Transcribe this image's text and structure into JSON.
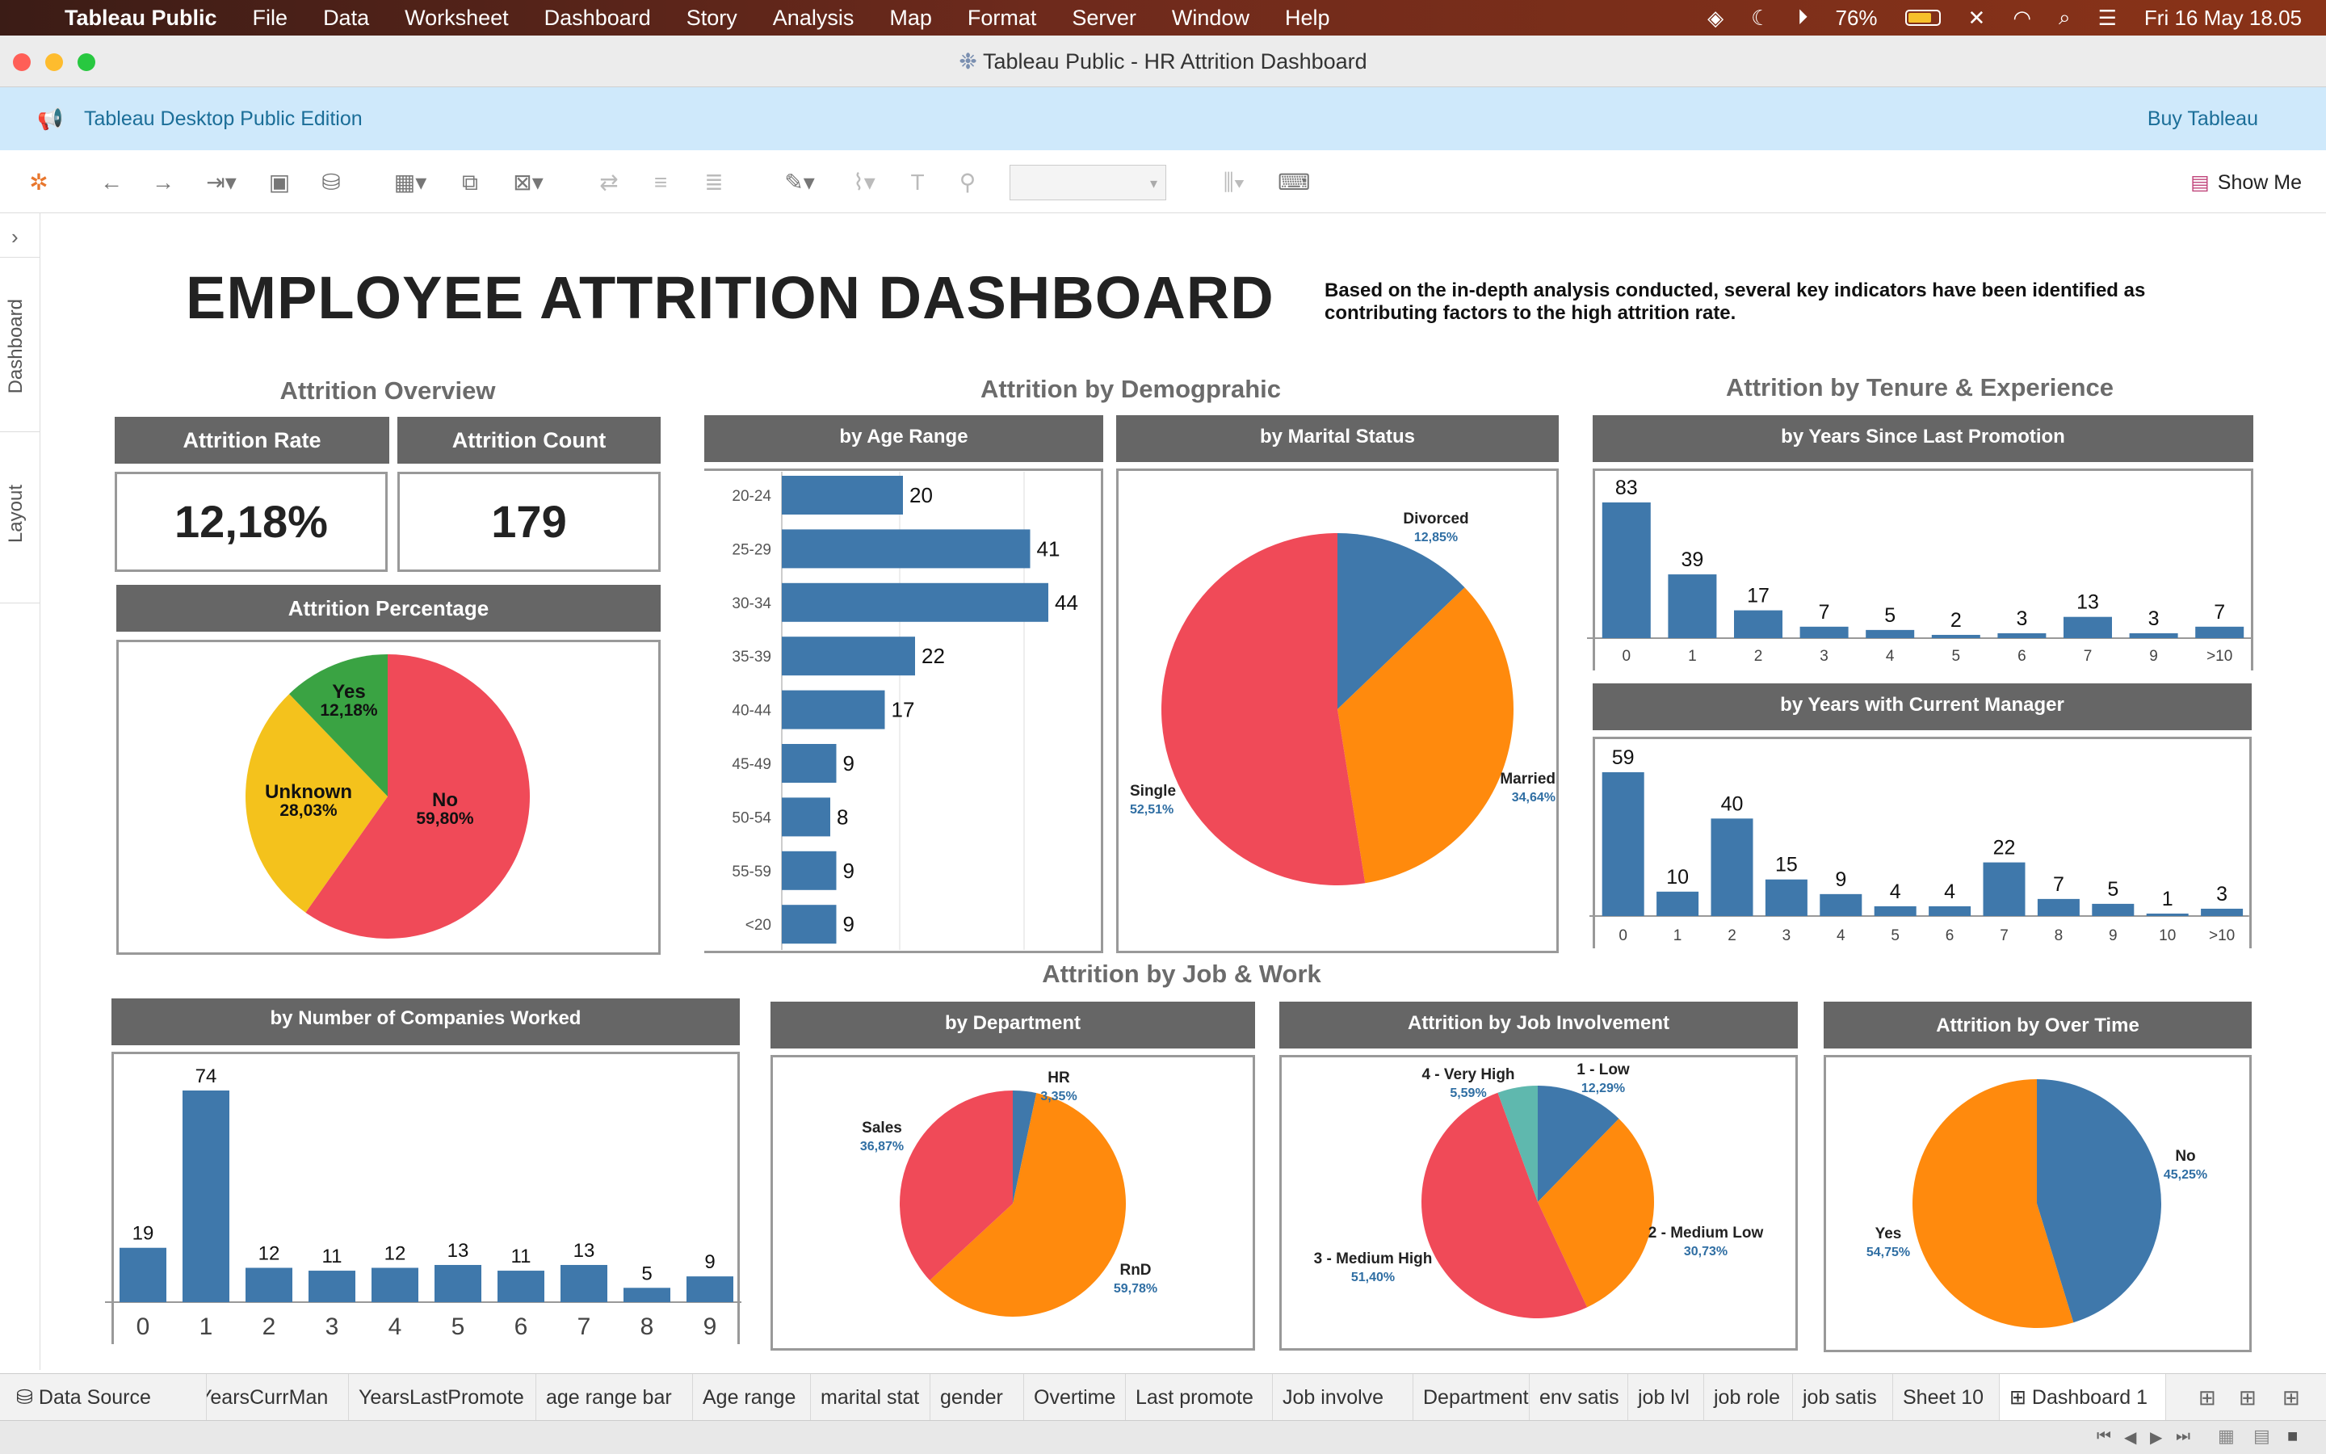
{
  "menubar": {
    "app": "Tableau Public",
    "items": [
      "File",
      "Data",
      "Worksheet",
      "Dashboard",
      "Story",
      "Analysis",
      "Map",
      "Format",
      "Server",
      "Window",
      "Help"
    ],
    "battery": "76%",
    "datetime": "Fri 16 May  18.05"
  },
  "window": {
    "title": "Tableau Public - HR Attrition Dashboard"
  },
  "banner": {
    "edition": "Tableau Desktop Public Edition",
    "buy": "Buy Tableau"
  },
  "toolbar": {
    "show_me": "Show Me"
  },
  "side": {
    "dashboard": "Dashboard",
    "layout": "Layout"
  },
  "dashboard": {
    "title": "EMPLOYEE ATTRITION DASHBOARD",
    "description": "Based on the in-depth analysis conducted, several key indicators have been identified as contributing factors to the high attrition rate.",
    "sections": {
      "overview": "Attrition Overview",
      "demographic": "Attrition by Demogprahic",
      "tenure": "Attrition by Tenure & Experience",
      "job": "Attrition by Job & Work"
    },
    "kpis": [
      {
        "label": "Attrition Rate",
        "value": "12,18%"
      },
      {
        "label": "Attrition Count",
        "value": "179"
      }
    ],
    "headers": {
      "percentage": "Attrition Percentage",
      "age": "by Age Range",
      "marital": "by Marital Status",
      "promotion": "by Years Since Last Promotion",
      "manager": "by Years with Current Manager",
      "companies": "by Number of Companies Worked",
      "department": "by Department",
      "involvement": "Attrition by Job Involvement",
      "overtime": "Attrition by Over Time"
    }
  },
  "chart_data": [
    {
      "id": "percentage",
      "type": "pie",
      "labels": [
        "No",
        "Unknown",
        "Yes"
      ],
      "values": [
        59.8,
        28.03,
        12.18
      ],
      "display": [
        "59,80%",
        "28,03%",
        "12,18%"
      ],
      "colors": [
        "#f04a58",
        "#f4c21c",
        "#3aa343"
      ]
    },
    {
      "id": "age",
      "type": "bar",
      "orientation": "horizontal",
      "categories": [
        "20-24",
        "25-29",
        "30-34",
        "35-39",
        "40-44",
        "45-49",
        "50-54",
        "55-59",
        "<20"
      ],
      "values": [
        20,
        41,
        44,
        22,
        17,
        9,
        8,
        9,
        9
      ],
      "xlim": [
        0,
        50
      ],
      "color": "#3f78ab"
    },
    {
      "id": "marital",
      "type": "pie",
      "labels": [
        "Divorced",
        "Married",
        "Single"
      ],
      "values": [
        12.85,
        34.64,
        52.51
      ],
      "display": [
        "12,85%",
        "34,64%",
        "52,51%"
      ],
      "colors": [
        "#3f78ab",
        "#ff8a0d",
        "#f04a58"
      ]
    },
    {
      "id": "promotion",
      "type": "bar",
      "categories": [
        "0",
        "1",
        "2",
        "3",
        "4",
        "5",
        "6",
        "7",
        "9",
        ">10"
      ],
      "values": [
        83,
        39,
        17,
        7,
        5,
        2,
        3,
        13,
        3,
        7
      ],
      "color": "#3f78ab"
    },
    {
      "id": "manager",
      "type": "bar",
      "categories": [
        "0",
        "1",
        "2",
        "3",
        "4",
        "5",
        "6",
        "7",
        "8",
        "9",
        "10",
        ">10"
      ],
      "values": [
        59,
        10,
        40,
        15,
        9,
        4,
        4,
        22,
        7,
        5,
        1,
        3
      ],
      "color": "#3f78ab"
    },
    {
      "id": "companies",
      "type": "bar",
      "categories": [
        "0",
        "1",
        "2",
        "3",
        "4",
        "5",
        "6",
        "7",
        "8",
        "9"
      ],
      "values": [
        19,
        74,
        12,
        11,
        12,
        13,
        11,
        13,
        5,
        9
      ],
      "color": "#3f78ab"
    },
    {
      "id": "department",
      "type": "pie",
      "labels": [
        "HR",
        "RnD",
        "Sales"
      ],
      "values": [
        3.35,
        59.78,
        36.87
      ],
      "display": [
        "3,35%",
        "59,78%",
        "36,87%"
      ],
      "colors": [
        "#3f78ab",
        "#ff8a0d",
        "#f04a58"
      ]
    },
    {
      "id": "involvement",
      "type": "pie",
      "labels": [
        "1 - Low",
        "2 - Medium Low",
        "3 - Medium High",
        "4 - Very High"
      ],
      "values": [
        12.29,
        30.73,
        51.4,
        5.59
      ],
      "display": [
        "12,29%",
        "30,73%",
        "51,40%",
        "5,59%"
      ],
      "colors": [
        "#3f78ab",
        "#ff8a0d",
        "#f04a58",
        "#5fb8ae"
      ]
    },
    {
      "id": "overtime",
      "type": "pie",
      "labels": [
        "No",
        "Yes"
      ],
      "values": [
        45.25,
        54.75
      ],
      "display": [
        "45,25%",
        "54,75%"
      ],
      "colors": [
        "#3f78ab",
        "#ff8a0d"
      ]
    }
  ],
  "sheet_tabs": [
    "Data Source",
    "YearsCurrMan",
    "YearsLastPromote",
    "age range bar",
    "Age range",
    "marital stat",
    "gender",
    "Overtime",
    "Last promote",
    "Job involve",
    "Department",
    "env satis",
    "job lvl",
    "job role",
    "job satis",
    "Sheet 10",
    "Dashboard 1"
  ],
  "icons": [
    "apple-icon",
    "tableau-logo-icon",
    "back-icon",
    "forward-icon",
    "save-icon",
    "new-datasource-icon",
    "new-worksheet-icon",
    "duplicate-icon",
    "clear-icon",
    "swap-icon",
    "sort-asc-icon",
    "sort-desc-icon",
    "highlight-icon",
    "annotate-icon",
    "label-icon",
    "pin-icon",
    "fit-icon",
    "presentation-icon",
    "show-me-icon",
    "megaphone-icon"
  ]
}
